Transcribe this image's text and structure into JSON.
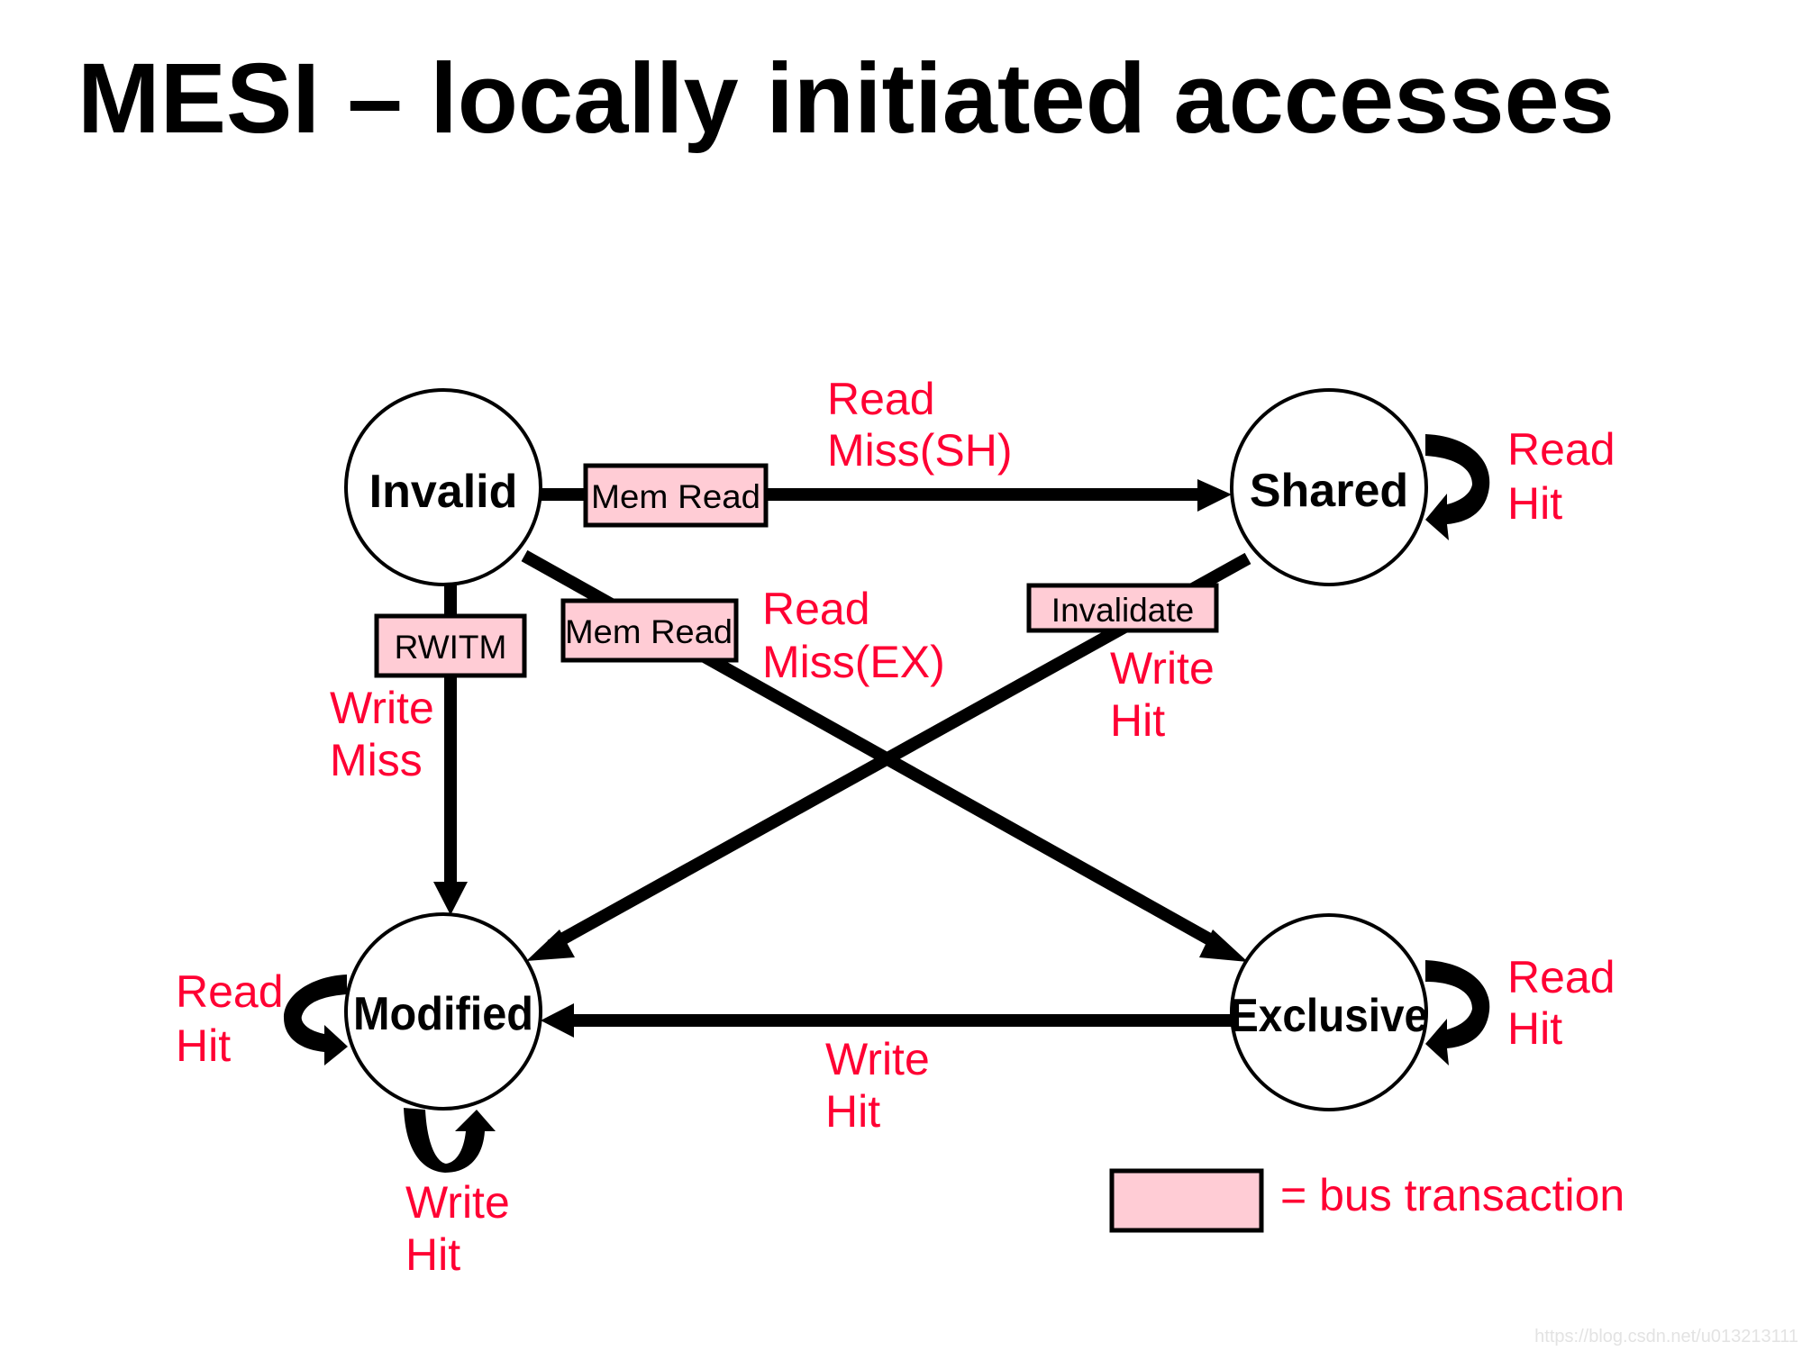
{
  "title": "MESI – locally initiated accesses",
  "colors": {
    "label": "#ff0033",
    "bus_fill": "#ffccd5",
    "line": "#000000"
  },
  "states": {
    "invalid": "Invalid",
    "shared": "Shared",
    "modified": "Modified",
    "exclusive": "Exclusive"
  },
  "transitions": [
    {
      "from": "Invalid",
      "to": "Shared",
      "event": [
        "Read",
        "Miss(SH)"
      ],
      "bus": "Mem Read"
    },
    {
      "from": "Invalid",
      "to": "Exclusive",
      "event": [
        "Read",
        "Miss(EX)"
      ],
      "bus": "Mem Read"
    },
    {
      "from": "Invalid",
      "to": "Modified",
      "event": [
        "Write",
        "Miss"
      ],
      "bus": "RWITM"
    },
    {
      "from": "Shared",
      "to": "Modified",
      "event": [
        "Write",
        "Hit"
      ],
      "bus": "Invalidate"
    },
    {
      "from": "Exclusive",
      "to": "Modified",
      "event": [
        "Write",
        "Hit"
      ],
      "bus": null
    },
    {
      "from": "Shared",
      "to": "Shared",
      "event": [
        "Read",
        "Hit"
      ],
      "bus": null
    },
    {
      "from": "Modified",
      "to": "Modified",
      "event": [
        "Read",
        "Hit"
      ],
      "bus": null
    },
    {
      "from": "Modified",
      "to": "Modified",
      "event": [
        "Write",
        "Hit"
      ],
      "bus": null
    },
    {
      "from": "Exclusive",
      "to": "Exclusive",
      "event": [
        "Read",
        "Hit"
      ],
      "bus": null
    }
  ],
  "legend": {
    "text": "= bus transaction"
  },
  "watermark": "https://blog.csdn.net/u013213111"
}
